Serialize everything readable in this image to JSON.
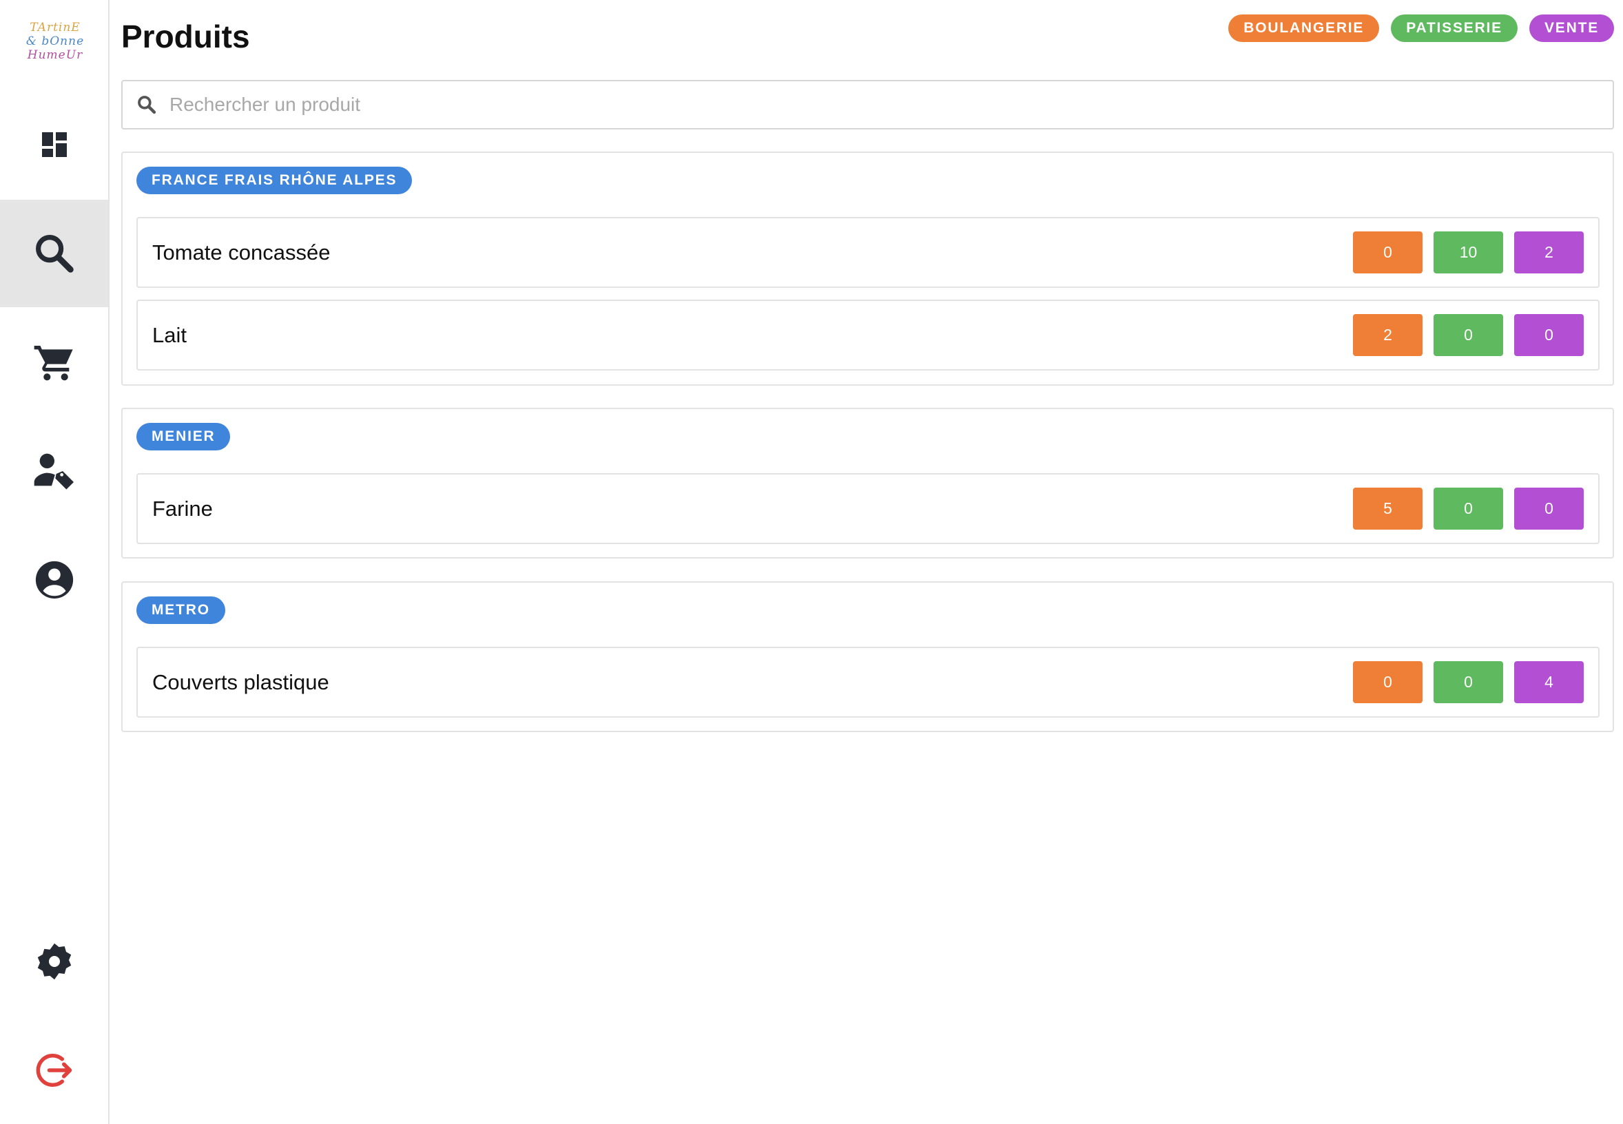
{
  "logo": {
    "lines": [
      "TArtinE",
      "& bOnne",
      "HumeUr"
    ]
  },
  "page": {
    "title": "Produits"
  },
  "categories": [
    {
      "label": "BOULANGERIE",
      "color": "#ef7f36"
    },
    {
      "label": "PATISSERIE",
      "color": "#5fba5f"
    },
    {
      "label": "VENTE",
      "color": "#b24fd3"
    }
  ],
  "search": {
    "placeholder": "Rechercher un produit",
    "value": ""
  },
  "nav": [
    {
      "icon": "dashboard-icon",
      "active": false
    },
    {
      "icon": "search-icon",
      "active": true
    },
    {
      "icon": "cart-icon",
      "active": false
    },
    {
      "icon": "supplier-tag-icon",
      "active": false
    },
    {
      "icon": "account-icon",
      "active": false
    },
    {
      "icon": "settings-icon",
      "active": false
    },
    {
      "icon": "logout-icon",
      "active": false
    }
  ],
  "colors": {
    "supplier_badge": "#3f85dc",
    "logout": "#e0413c",
    "icons": "#262b33"
  },
  "suppliers": [
    {
      "name": "FRANCE FRAIS RHÔNE ALPES",
      "products": [
        {
          "name": "Tomate concassée",
          "counts": [
            "0",
            "10",
            "2"
          ]
        },
        {
          "name": "Lait",
          "counts": [
            "2",
            "0",
            "0"
          ]
        }
      ]
    },
    {
      "name": "MENIER",
      "products": [
        {
          "name": "Farine",
          "counts": [
            "5",
            "0",
            "0"
          ]
        }
      ]
    },
    {
      "name": "METRO",
      "products": [
        {
          "name": "Couverts plastique",
          "counts": [
            "0",
            "0",
            "4"
          ]
        }
      ]
    }
  ]
}
